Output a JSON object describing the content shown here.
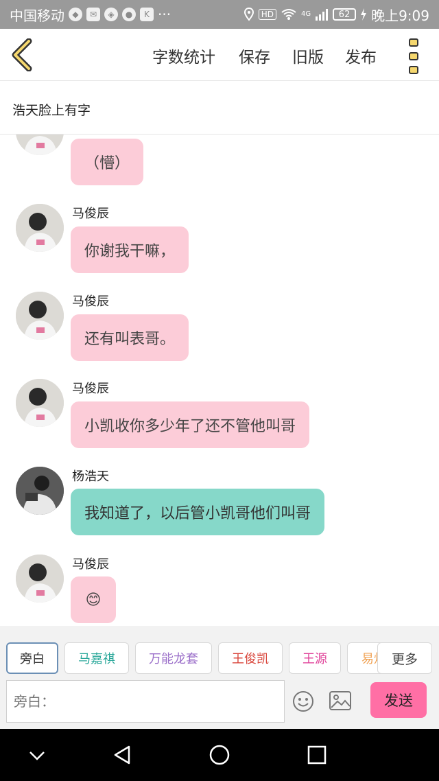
{
  "status_bar": {
    "carrier": "中国移动",
    "dots": "···",
    "hd": "HD",
    "network": "4G",
    "battery": "62",
    "time": "晚上9:09"
  },
  "toolbar": {
    "word_count": "字数统计",
    "save": "保存",
    "old_version": "旧版",
    "publish": "发布"
  },
  "story": {
    "title": "浩天脸上有字"
  },
  "messages": [
    {
      "speaker": "",
      "text": "（懵）",
      "color": "#fcccd8"
    },
    {
      "speaker": "马俊辰",
      "text": "你谢我干嘛，",
      "color": "#fcccd8"
    },
    {
      "speaker": "马俊辰",
      "text": "还有叫表哥。",
      "color": "#fcccd8"
    },
    {
      "speaker": "马俊辰",
      "text": "小凯收你多少年了还不管他叫哥",
      "color": "#fcccd8"
    },
    {
      "speaker": "杨浩天",
      "text": "我知道了，以后管小凯哥他们叫哥",
      "color": "#86d8c9"
    },
    {
      "speaker": "马俊辰",
      "text": "😊",
      "color": "#fcccd8"
    }
  ],
  "role_chips": [
    {
      "label": "旁白",
      "color": "#333333"
    },
    {
      "label": "马嘉祺",
      "color": "#2aa89a"
    },
    {
      "label": "万能龙套",
      "color": "#9b6fc9"
    },
    {
      "label": "王俊凯",
      "color": "#d9453b"
    },
    {
      "label": "王源",
      "color": "#e0439a"
    },
    {
      "label": "易烊",
      "color": "#f0a050"
    }
  ],
  "more_label": "更多",
  "input": {
    "placeholder": "旁白："
  },
  "send_label": "发送"
}
